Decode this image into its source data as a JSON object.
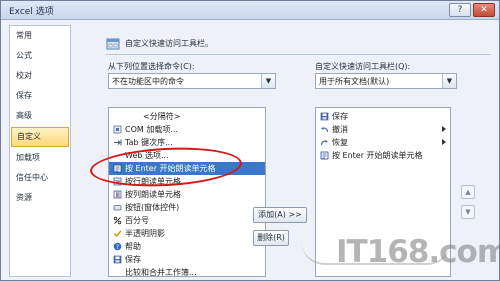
{
  "window": {
    "title": "Excel 选项",
    "help_glyph": "?",
    "close_glyph": "✕"
  },
  "sidebar": {
    "items": [
      {
        "label": "常用"
      },
      {
        "label": "公式"
      },
      {
        "label": "校对"
      },
      {
        "label": "保存"
      },
      {
        "label": "高级"
      },
      {
        "label": "自定义"
      },
      {
        "label": "加载项"
      },
      {
        "label": "信任中心"
      },
      {
        "label": "资源"
      }
    ],
    "active_index": 5
  },
  "header": {
    "text": "自定义快速访问工具栏。"
  },
  "left_panel": {
    "label": "从下列位置选择命令(C):",
    "select_value": "不在功能区中的命令",
    "list": [
      {
        "label": "<分隔符>",
        "icon": "none"
      },
      {
        "label": "COM 加载项...",
        "icon": "com-addin-icon"
      },
      {
        "label": "Tab 键次序...",
        "icon": "tab-order-icon"
      },
      {
        "label": "Web 选项...",
        "icon": "none"
      },
      {
        "label": "按 Enter 开始朗读单元格",
        "icon": "speak-on-enter-icon"
      },
      {
        "label": "按行朗读单元格",
        "icon": "speak-by-rows-icon"
      },
      {
        "label": "按列朗读单元格",
        "icon": "speak-by-columns-icon"
      },
      {
        "label": "按钮(窗体控件)",
        "icon": "button-control-icon"
      },
      {
        "label": "百分号",
        "icon": "percent-icon"
      },
      {
        "label": "半透明阴影",
        "icon": "checkmark-icon"
      },
      {
        "label": "帮助",
        "icon": "help-icon"
      },
      {
        "label": "保存",
        "icon": "save-icon"
      },
      {
        "label": "比较和合并工作簿...",
        "icon": "none"
      }
    ],
    "selected_index": 4
  },
  "middle_buttons": {
    "add": "添加(A) >>",
    "remove": "删除(R)"
  },
  "right_panel": {
    "label": "自定义快速访问工具栏(Q):",
    "select_value": "用于所有文档(默认)",
    "list": [
      {
        "label": "保存",
        "icon": "save-icon"
      },
      {
        "label": "撤消",
        "icon": "undo-icon"
      },
      {
        "label": "恢复",
        "icon": "redo-icon"
      },
      {
        "label": "按 Enter 开始朗读单元格",
        "icon": "speak-on-enter-icon"
      }
    ],
    "move_up_glyph": "▲",
    "move_down_glyph": "▼"
  },
  "watermark": {
    "text": "IT168.com"
  },
  "colors": {
    "selection": "#3a76cc",
    "annotation_oval": "#d71616",
    "active_sidebar": "#ffd777"
  }
}
